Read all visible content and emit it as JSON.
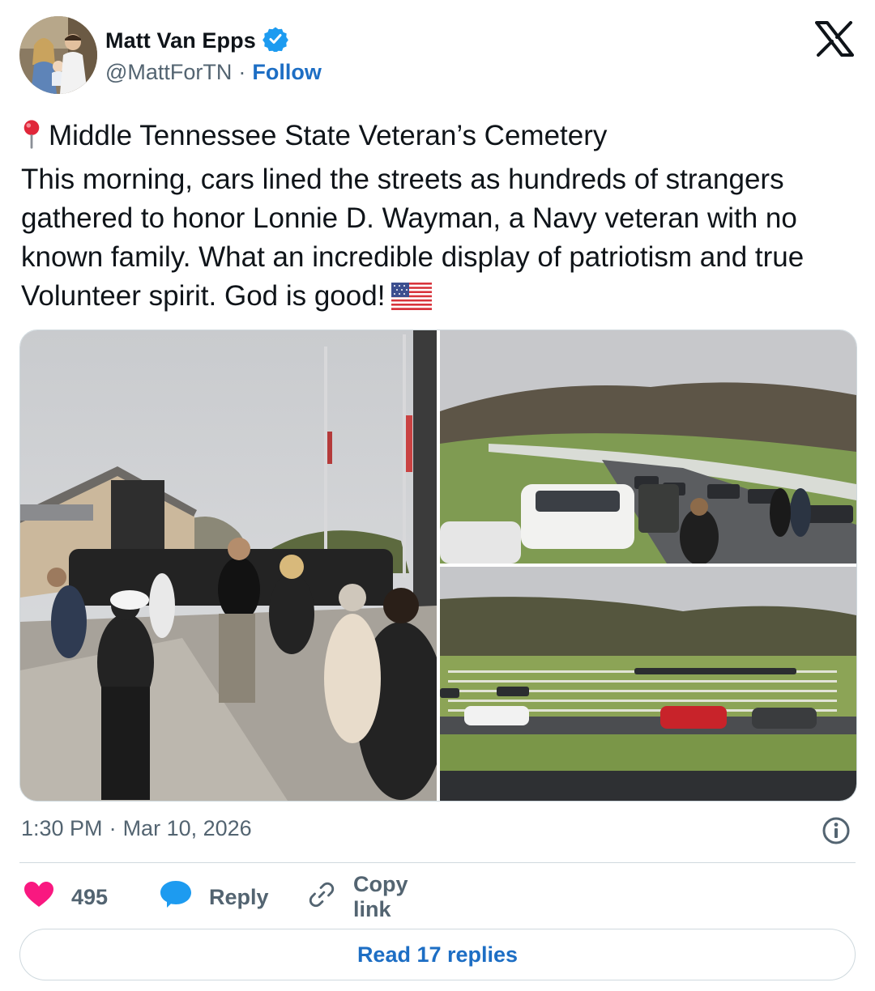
{
  "author": {
    "name": "Matt Van Epps",
    "handle": "@MattForTN",
    "separator": "·",
    "follow_label": "Follow"
  },
  "tweet": {
    "line1": "Middle Tennessee State Veteran’s Cemetery",
    "body": "This morning, cars lined the streets as hundreds of strangers gathered to honor Lonnie D. Wayman, a Navy veteran with no known family. What an incredible display of patriotism and true Volunteer spirit. God is good!"
  },
  "meta": {
    "time": "1:30 PM",
    "separator": "·",
    "date": "Mar 10, 2026"
  },
  "actions": {
    "likes": "495",
    "reply_label": "Reply",
    "copy_label": "Copy link"
  },
  "read_replies_label": "Read 17 replies",
  "colors": {
    "accent_blue": "#1d6ec4",
    "like_pink": "#f91880",
    "reply_blue": "#1d9bf0",
    "muted": "#536471",
    "border": "#cfd9de"
  },
  "icons": [
    "verified-badge-icon",
    "x-logo-icon",
    "pin-icon",
    "us-flag-icon",
    "info-icon",
    "heart-icon",
    "reply-bubble-icon",
    "link-icon"
  ]
}
